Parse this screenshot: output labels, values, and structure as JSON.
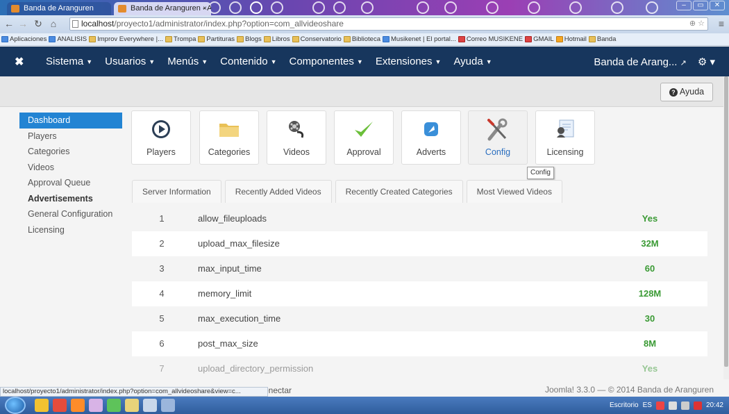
{
  "browser": {
    "tabs": [
      {
        "label": "Banda de Aranguren"
      },
      {
        "label": "Banda de Aranguren - Ad"
      }
    ],
    "close_glyph": "×",
    "url_host": "localhost",
    "url_path": "/proyecto1/administrator/index.php?option=com_allvideoshare",
    "bookmarks": [
      "Aplicaciones",
      "ANALISIS",
      "Improv Everywhere |...",
      "Trompa",
      "Partituras",
      "Blogs",
      "Libros",
      "Conservatorio",
      "Biblioteca",
      "Musikenet | El portal...",
      "Correo MUSIKENE",
      "GMAIL",
      "Hotmail",
      "Banda"
    ],
    "status_url": "localhost/proyecto1/administrator/index.php?option=com_allvideoshare&view=c..."
  },
  "navbar": {
    "menu": [
      "Sistema",
      "Usuarios",
      "Menús",
      "Contenido",
      "Componentes",
      "Extensiones",
      "Ayuda"
    ],
    "site_name": "Banda de Arang...",
    "colors": {
      "background": "#17365d"
    }
  },
  "toolbar": {
    "help_label": "Ayuda"
  },
  "sidebar": {
    "items": [
      "Dashboard",
      "Players",
      "Categories",
      "Videos",
      "Approval Queue",
      "Advertisements",
      "General Configuration",
      "Licensing"
    ]
  },
  "icon_buttons": [
    {
      "label": "Players",
      "icon": "play-icon"
    },
    {
      "label": "Categories",
      "icon": "folder-icon"
    },
    {
      "label": "Videos",
      "icon": "film-reel-icon"
    },
    {
      "label": "Approval",
      "icon": "checkmark-icon"
    },
    {
      "label": "Adverts",
      "icon": "rocket-icon"
    },
    {
      "label": "Config",
      "icon": "tools-icon"
    },
    {
      "label": "Licensing",
      "icon": "certificate-icon"
    }
  ],
  "tooltip": "Config",
  "tabs": [
    "Server Information",
    "Recently Added Videos",
    "Recently Created Categories",
    "Most Viewed Videos"
  ],
  "server_info": [
    {
      "n": "1",
      "key": "allow_fileuploads",
      "value": "Yes"
    },
    {
      "n": "2",
      "key": "upload_max_filesize",
      "value": "32M"
    },
    {
      "n": "3",
      "key": "max_input_time",
      "value": "60"
    },
    {
      "n": "4",
      "key": "memory_limit",
      "value": "128M"
    },
    {
      "n": "5",
      "key": "max_execution_time",
      "value": "30"
    },
    {
      "n": "6",
      "key": "post_max_size",
      "value": "8M"
    },
    {
      "n": "7",
      "key": "upload_directory_permission",
      "value": "Yes"
    }
  ],
  "value_color": "#3a9a34",
  "footer": {
    "text": "Joomla! 3.3.0 — © 2014 Banda de Aranguren",
    "behind_text": "onectar"
  },
  "taskbar": {
    "desk_label": "Escritorio",
    "lang": "ES",
    "time": "20:42"
  }
}
